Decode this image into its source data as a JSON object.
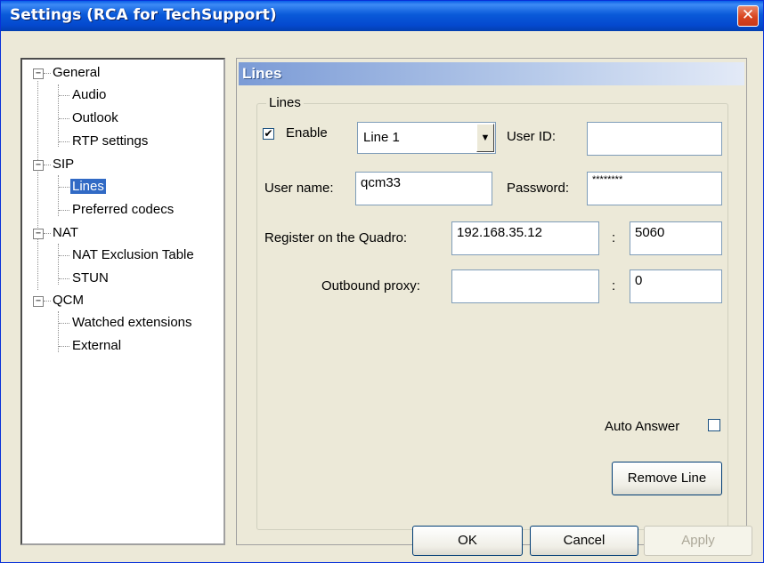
{
  "window": {
    "title": "Settings (RCA for TechSupport)",
    "close_glyph": "✕"
  },
  "tree": {
    "groups": [
      {
        "label": "General",
        "expander": "−",
        "children": [
          "Audio",
          "Outlook",
          "RTP settings"
        ]
      },
      {
        "label": "SIP",
        "expander": "−",
        "children": [
          "Lines",
          "Preferred codecs"
        ]
      },
      {
        "label": "NAT",
        "expander": "−",
        "children": [
          "NAT Exclusion Table",
          "STUN"
        ]
      },
      {
        "label": "QCM",
        "expander": "−",
        "children": [
          "Watched extensions",
          "External"
        ]
      }
    ],
    "selected": "Lines"
  },
  "panel": {
    "header": "Lines",
    "group_title": "Lines",
    "enable": {
      "label": "Enable",
      "checked": true,
      "mark": "✔"
    },
    "line_select": {
      "value": "Line 1",
      "arrow": "▼"
    },
    "user_id": {
      "label": "User ID:",
      "value": ""
    },
    "user_name": {
      "label": "User name:",
      "value": "qcm33"
    },
    "password": {
      "label": "Password:",
      "value": "********"
    },
    "register": {
      "label": "Register on the Quadro:",
      "ip": "192.168.35.12",
      "sep": ":",
      "port": "5060"
    },
    "outbound": {
      "label": "Outbound proxy:",
      "value": "",
      "sep": ":",
      "port": "0"
    },
    "auto_answer": {
      "label": "Auto Answer",
      "checked": false
    },
    "remove_line": "Remove Line"
  },
  "buttons": {
    "ok": "OK",
    "cancel": "Cancel",
    "apply": "Apply"
  }
}
